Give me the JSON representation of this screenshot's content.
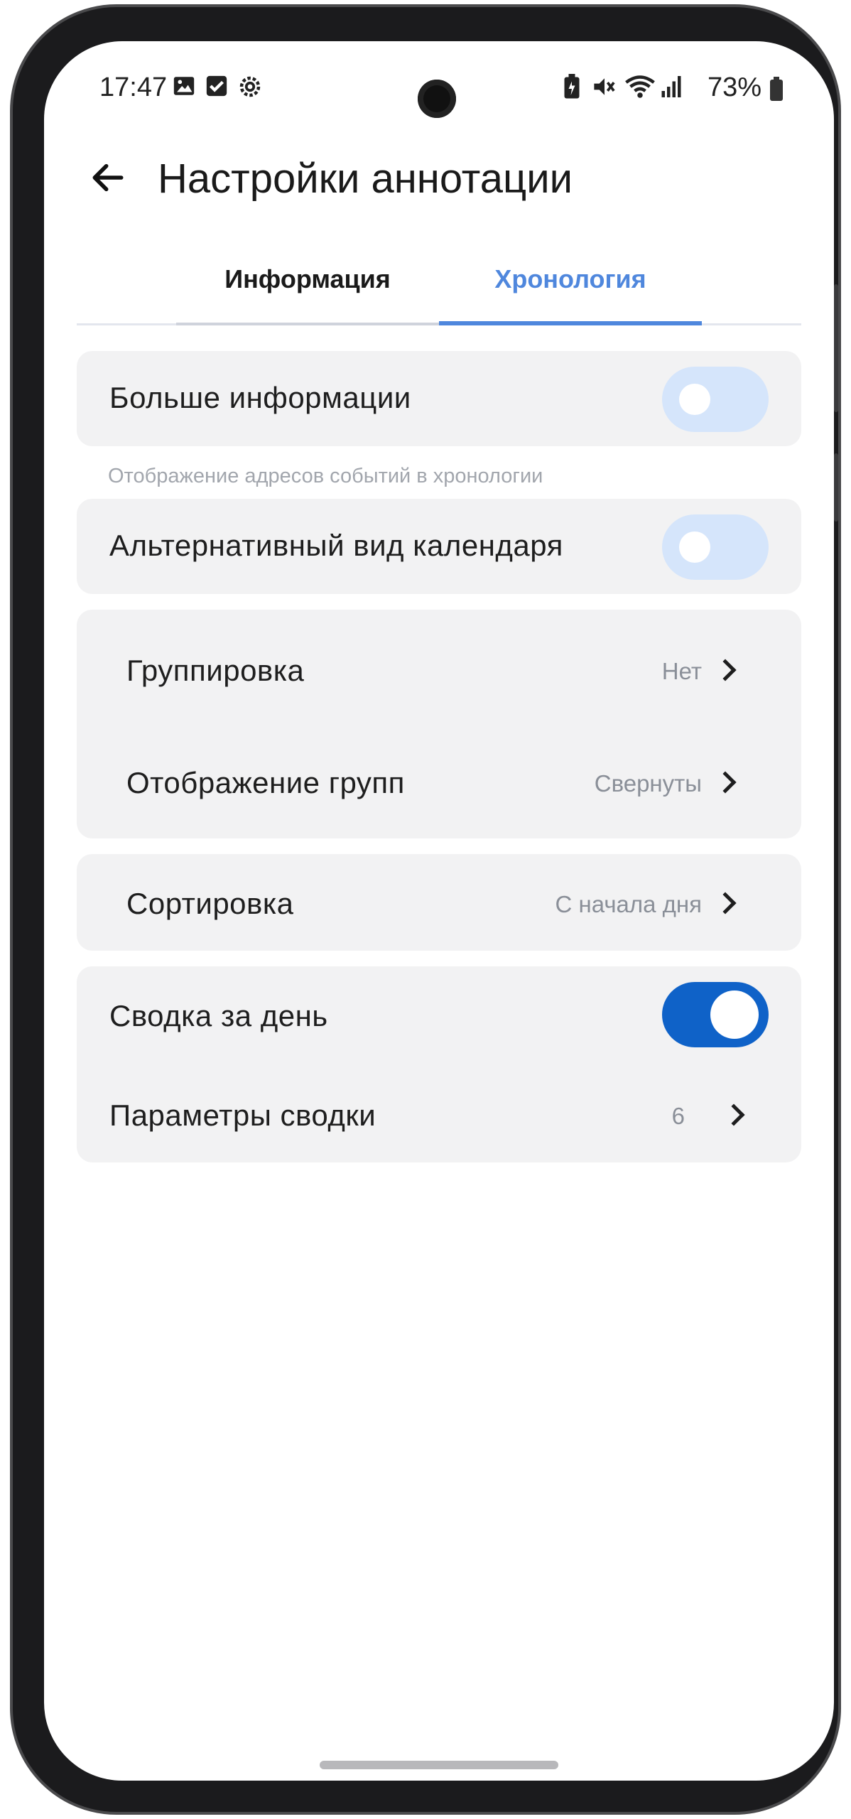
{
  "status_bar": {
    "time": "17:47",
    "battery": "73%",
    "left_icons": [
      "image-icon",
      "checkbox-icon",
      "settings-icon"
    ],
    "right_icons": [
      "battery-saver-icon",
      "mute-icon",
      "wifi-icon",
      "signal-icon"
    ]
  },
  "header": {
    "title": "Настройки аннотации",
    "back_icon": "arrow-left-icon"
  },
  "tabs": [
    {
      "label": "Информация",
      "active": false
    },
    {
      "label": "Хронология",
      "active": true
    }
  ],
  "settings": {
    "more_info": {
      "label": "Больше информации",
      "enabled": false,
      "hint": "Отображение адресов событий в хронологии"
    },
    "alt_calendar": {
      "label": "Альтернативный вид календаря",
      "enabled": false
    },
    "grouping": {
      "label": "Группировка",
      "value": "Нет"
    },
    "group_display": {
      "label": "Отображение групп",
      "value": "Свернуты"
    },
    "sorting": {
      "label": "Сортировка",
      "value": "С начала дня"
    },
    "daily_summary": {
      "label": "Сводка за день",
      "enabled": true
    },
    "summary_params": {
      "label": "Параметры сводки",
      "value": "6"
    }
  },
  "colors": {
    "accent": "#4f87dd",
    "toggle_on": "#0f62c8",
    "toggle_off": "#d5e5fb",
    "card_bg": "#f2f2f3"
  }
}
